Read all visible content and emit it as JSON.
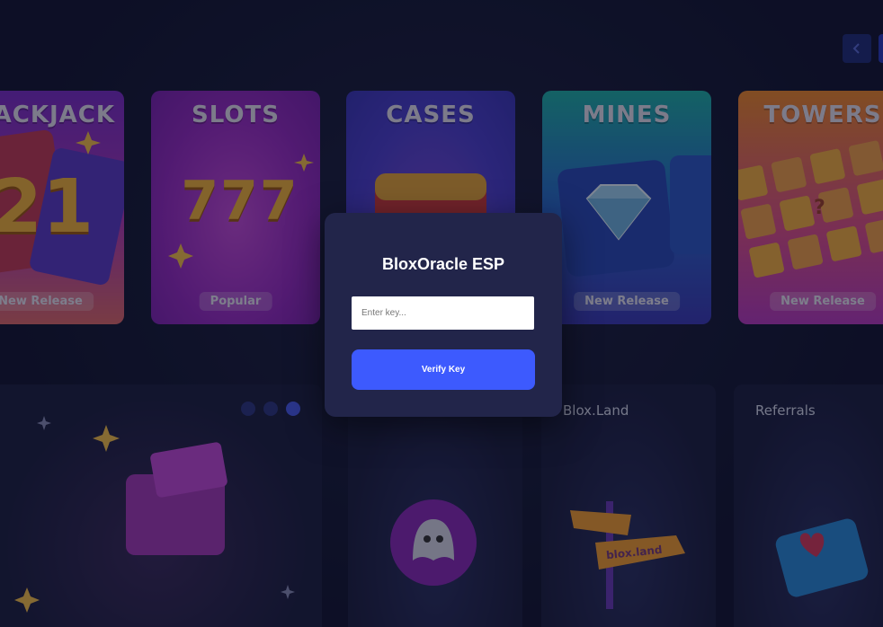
{
  "carousel_nav": {
    "prev_icon": "chevron-left-icon",
    "next_icon": "chevron-right-icon"
  },
  "game_cards": [
    {
      "title": "ACKJACK",
      "badge": "New Release",
      "art_text": "21"
    },
    {
      "title": "SLOTS",
      "badge": "Popular",
      "art_text": "777"
    },
    {
      "title": "CASES",
      "badge": ""
    },
    {
      "title": "MINES",
      "badge": "New Release"
    },
    {
      "title": "TOWERS",
      "badge": "New Release",
      "art_text": "?"
    }
  ],
  "promo": {
    "dots": 3,
    "active_dot": 2
  },
  "bottom_cards": [
    {
      "title": ""
    },
    {
      "title": "Blox.Land",
      "sign_text": "blox.land"
    },
    {
      "title": "Referrals"
    }
  ],
  "modal": {
    "title": "BloxOracle ESP",
    "input_placeholder": "Enter key...",
    "input_value": "",
    "button_label": "Verify Key"
  },
  "colors": {
    "background": "#121530",
    "modal_bg": "#22254a",
    "accent": "#3d5afe",
    "slots": "#a02cc8",
    "cases": "#4b3fd0",
    "mines": "#1fb2a8",
    "towers": "#f08a2a"
  }
}
